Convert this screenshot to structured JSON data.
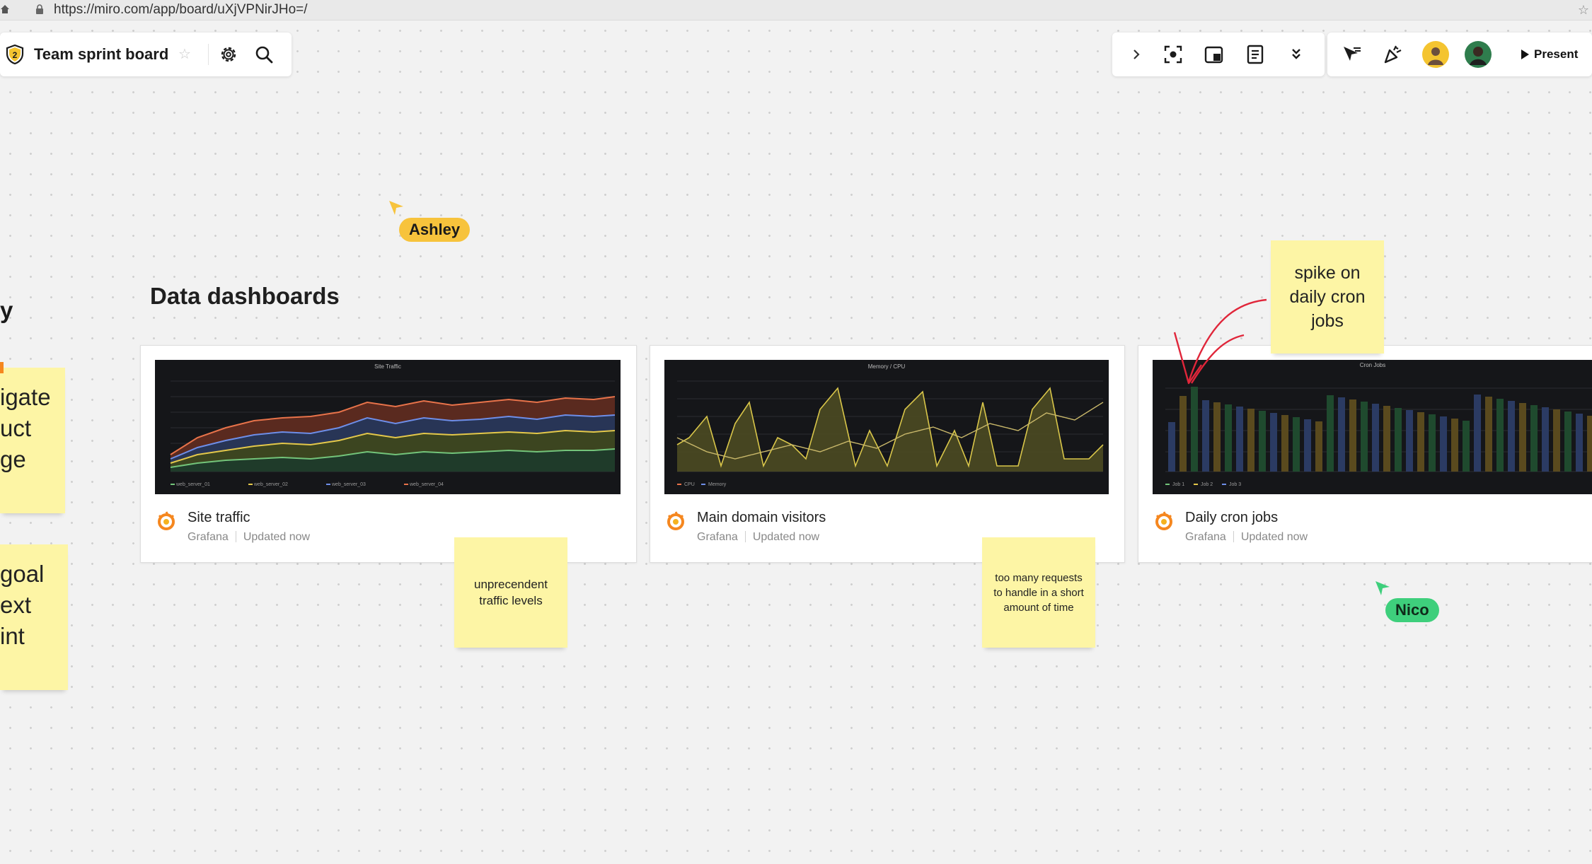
{
  "browser": {
    "url": "https://miro.com/app/board/uXjVPNirJHo=/"
  },
  "board": {
    "title": "Team sprint board",
    "badge": "2"
  },
  "toolbar": {
    "present_label": "Present"
  },
  "cursors": [
    {
      "name": "Ashley",
      "color": "#f7c33c"
    },
    {
      "name": "Nico",
      "color": "#3ecf7c"
    }
  ],
  "section": {
    "title": "Data dashboards",
    "left_partial_heading": "y"
  },
  "cards": [
    {
      "title": "Site traffic",
      "source": "Grafana",
      "updated": "Updated now",
      "chart_title": "Site Traffic",
      "legend": [
        "web_server_01",
        "web_server_02",
        "web_server_03",
        "web_server_04"
      ]
    },
    {
      "title": "Main domain visitors",
      "source": "Grafana",
      "updated": "Updated now",
      "chart_title": "Memory / CPU",
      "legend": [
        "CPU",
        "Memory"
      ]
    },
    {
      "title": "Daily cron jobs",
      "source": "Grafana",
      "updated": "Updated now",
      "chart_title": "Cron Jobs",
      "legend": [
        "Job 1",
        "Job 2",
        "Job 3"
      ]
    }
  ],
  "stickies": {
    "spike": "spike on daily cron jobs",
    "traffic": "unprecendent traffic levels",
    "requests": "too many requests to handle in a short amount of time",
    "left_top": [
      "igate",
      "uct",
      "ge"
    ],
    "left_bottom": [
      "goal",
      "ext",
      "int"
    ]
  },
  "colors": {
    "sticky": "#fdf5a5",
    "annotation_arrow": "#e0263a",
    "grafana_orange": "#f5871f"
  }
}
